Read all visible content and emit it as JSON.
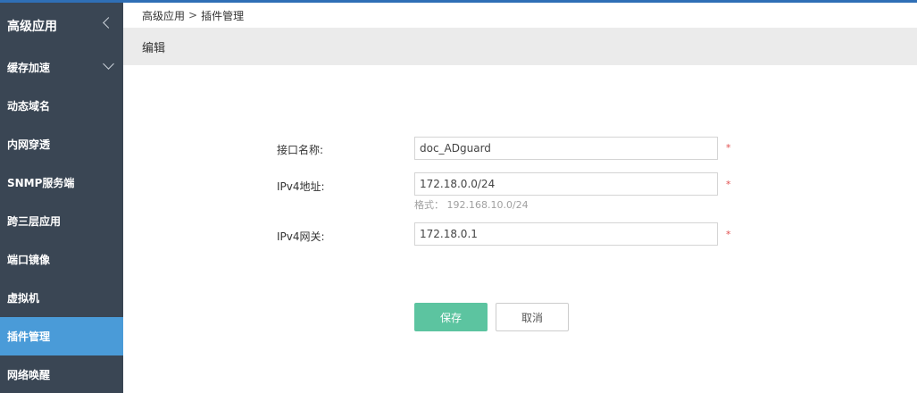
{
  "sidebar": {
    "header": "高级应用",
    "items": [
      {
        "label": "缓存加速",
        "expandable": true
      },
      {
        "label": "动态域名"
      },
      {
        "label": "内网穿透"
      },
      {
        "label": "SNMP服务端"
      },
      {
        "label": "跨三层应用"
      },
      {
        "label": "端口镜像"
      },
      {
        "label": "虚拟机"
      },
      {
        "label": "插件管理",
        "active": true
      },
      {
        "label": "网络唤醒"
      }
    ]
  },
  "breadcrumb": {
    "parent": "高级应用",
    "separator": ">",
    "current": "插件管理"
  },
  "section": {
    "title": "编辑"
  },
  "form": {
    "interface_name": {
      "label": "接口名称:",
      "value": "doc_ADguard",
      "required_mark": "*"
    },
    "ipv4_address": {
      "label": "IPv4地址:",
      "value": "172.18.0.0/24",
      "required_mark": "*",
      "hint": "格式： 192.168.10.0/24"
    },
    "ipv4_gateway": {
      "label": "IPv4网关:",
      "value": "172.18.0.1",
      "required_mark": "*"
    }
  },
  "buttons": {
    "save": "保存",
    "cancel": "取消"
  },
  "colors": {
    "sidebar_bg": "#3a4654",
    "active_item": "#4a9bd8",
    "save_button": "#5cc4a0",
    "required": "#e05050"
  }
}
